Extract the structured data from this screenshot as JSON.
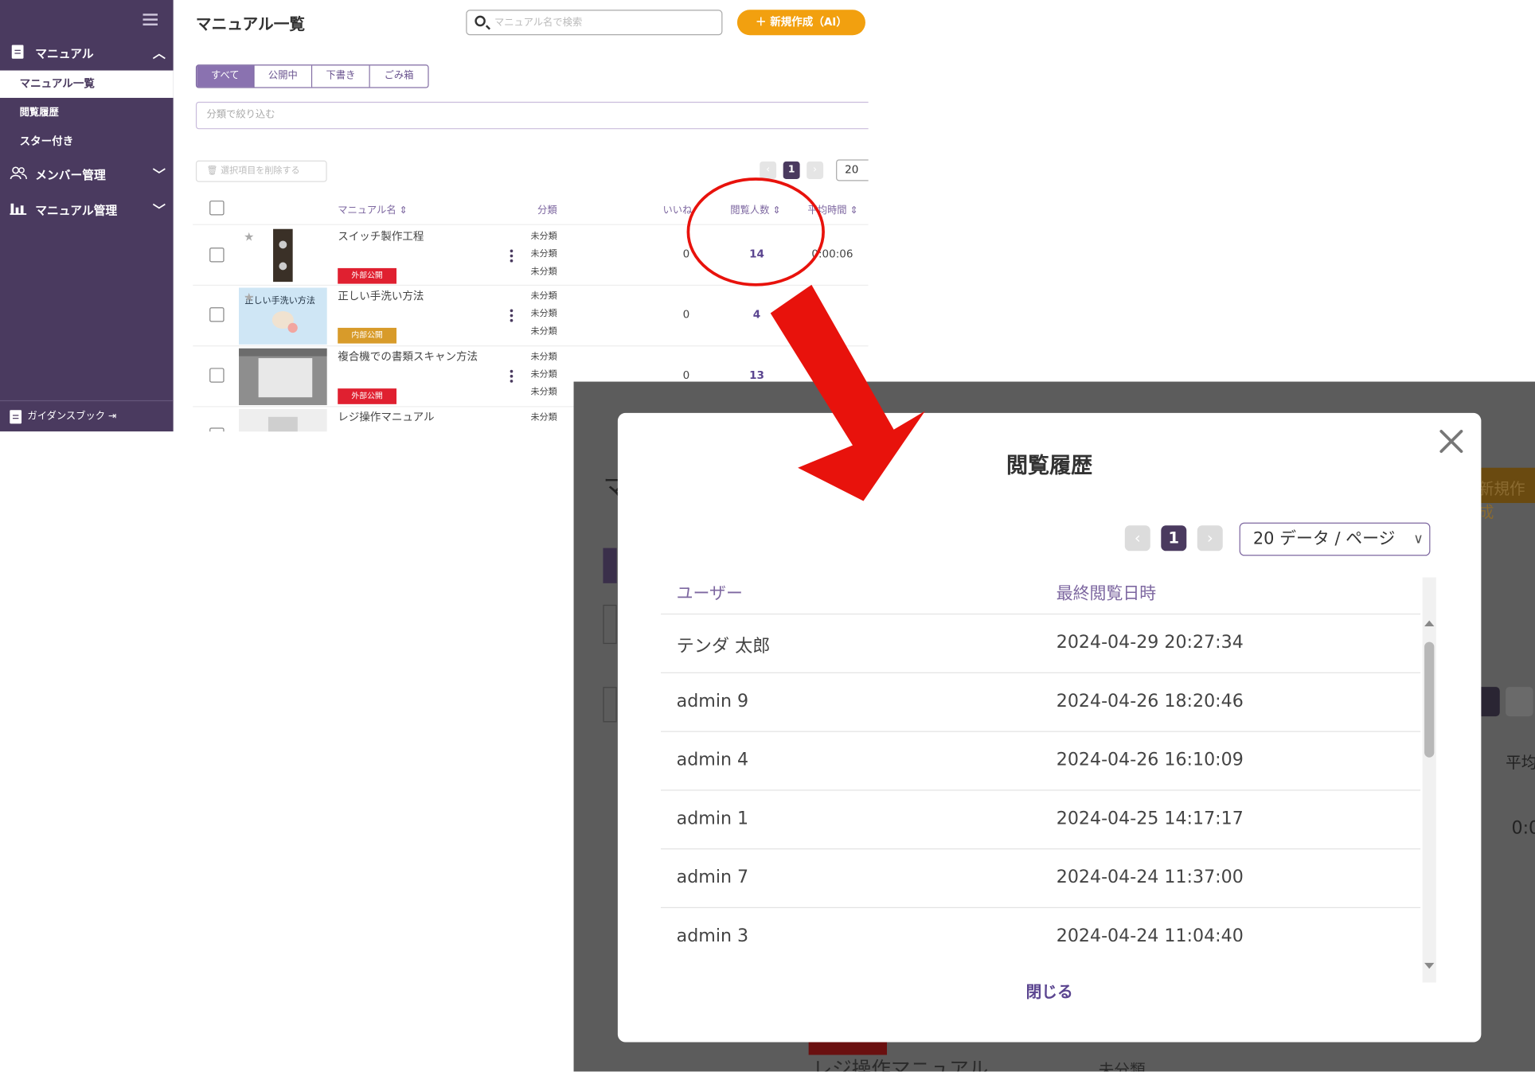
{
  "sidebar": {
    "manual_label": "マニュアル",
    "items": [
      {
        "label": "マニュアル一覧"
      },
      {
        "label": "閲覧履歴"
      },
      {
        "label": "スター付き"
      }
    ],
    "members_label": "メンバー管理",
    "manual_admin_label": "マニュアル管理",
    "guidebook_label": "ガイダンスブック"
  },
  "list_page": {
    "title": "マニュアル一覧",
    "search_placeholder": "マニュアル名で検索",
    "new_button": "＋ 新規作成（AI）",
    "tabs": [
      "すべて",
      "公開中",
      "下書き",
      "ごみ箱"
    ],
    "filter_placeholder": "分類で絞り込む",
    "bulk_delete": "🗑 選択項目を削除する",
    "pagination": {
      "current": "1",
      "per_page": "20"
    },
    "columns": {
      "name": "マニュアル名 ⇕",
      "category": "分類",
      "likes": "いいね",
      "viewers": "閲覧人数 ⇕",
      "avg_time": "平均時間 ⇕"
    },
    "rows": [
      {
        "name": "スイッチ製作工程",
        "badge": "外部公開",
        "categories": [
          "未分類",
          "未分類",
          "未分類"
        ],
        "likes": "0",
        "viewers": "14",
        "avg_time": "0:00:06"
      },
      {
        "name": "正しい手洗い方法",
        "badge": "内部公開",
        "thumb_text": "正しい手洗い方法",
        "categories": [
          "未分類",
          "未分類",
          "未分類"
        ],
        "likes": "0",
        "viewers": "4",
        "avg_time": ""
      },
      {
        "name": "複合機での書類スキャン方法",
        "badge": "外部公開",
        "categories": [
          "未分類",
          "未分類",
          "未分類"
        ],
        "likes": "0",
        "viewers": "13",
        "avg_time": ""
      },
      {
        "name": "レジ操作マニュアル",
        "badge": "",
        "categories": [
          "未分類"
        ],
        "likes": "",
        "viewers": "",
        "avg_time": ""
      }
    ]
  },
  "modal": {
    "title": "閲覧履歴",
    "pagination": {
      "current": "1",
      "per_page": "20 データ / ページ"
    },
    "columns": {
      "user": "ユーザー",
      "last_viewed": "最終閲覧日時"
    },
    "rows": [
      {
        "user": "テンダ 太郎",
        "date": "2024-04-29 20:27:34"
      },
      {
        "user": "admin 9",
        "date": "2024-04-26 18:20:46"
      },
      {
        "user": "admin 4",
        "date": "2024-04-26 16:10:09"
      },
      {
        "user": "admin 1",
        "date": "2024-04-25 14:17:17"
      },
      {
        "user": "admin 7",
        "date": "2024-04-24 11:37:00"
      },
      {
        "user": "admin 3",
        "date": "2024-04-24 11:04:40"
      }
    ],
    "close_label": "閉じる"
  },
  "background_fragments": {
    "title_char": "マ",
    "button_text": "新規作成",
    "avg_label": "平均",
    "time_text": "0:0",
    "row_name": "レジ操作マニュアル",
    "row_category": "未分類"
  },
  "colors": {
    "sidebar": "#4a3a5f",
    "accent": "#7d67a0",
    "primary_button": "#f2a00f",
    "external_badge": "#e02030",
    "internal_badge": "#d89b2a",
    "annotation": "#e8120c"
  }
}
